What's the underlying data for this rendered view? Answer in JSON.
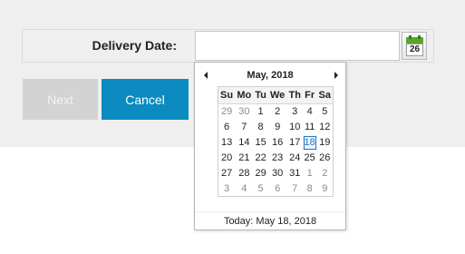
{
  "form": {
    "label": "Delivery Date:",
    "date_value": "",
    "calendar_button_day": "26"
  },
  "buttons": {
    "next_label": "Next",
    "cancel_label": "Cancel"
  },
  "calendar": {
    "month_title": "May, 2018",
    "weekdays": [
      "Su",
      "Mo",
      "Tu",
      "We",
      "Th",
      "Fr",
      "Sa"
    ],
    "weeks": [
      [
        "29",
        "30",
        "1",
        "2",
        "3",
        "4",
        "5"
      ],
      [
        "6",
        "7",
        "8",
        "9",
        "10",
        "11",
        "12"
      ],
      [
        "13",
        "14",
        "15",
        "16",
        "17",
        "18",
        "19"
      ],
      [
        "20",
        "21",
        "22",
        "23",
        "24",
        "25",
        "26"
      ],
      [
        "27",
        "28",
        "29",
        "30",
        "31",
        "1",
        "2"
      ],
      [
        "3",
        "4",
        "5",
        "6",
        "7",
        "8",
        "9"
      ]
    ],
    "selected_day": "18",
    "today_label": "Today: May 18, 2018"
  },
  "colors": {
    "accent": "#0b8bc0",
    "selected": "#2a78c2",
    "calendar_icon_green": "#5aa52a"
  },
  "icons": {
    "calendar": "calendar-icon",
    "prev": "chevron-left-icon",
    "next": "chevron-right-icon"
  }
}
